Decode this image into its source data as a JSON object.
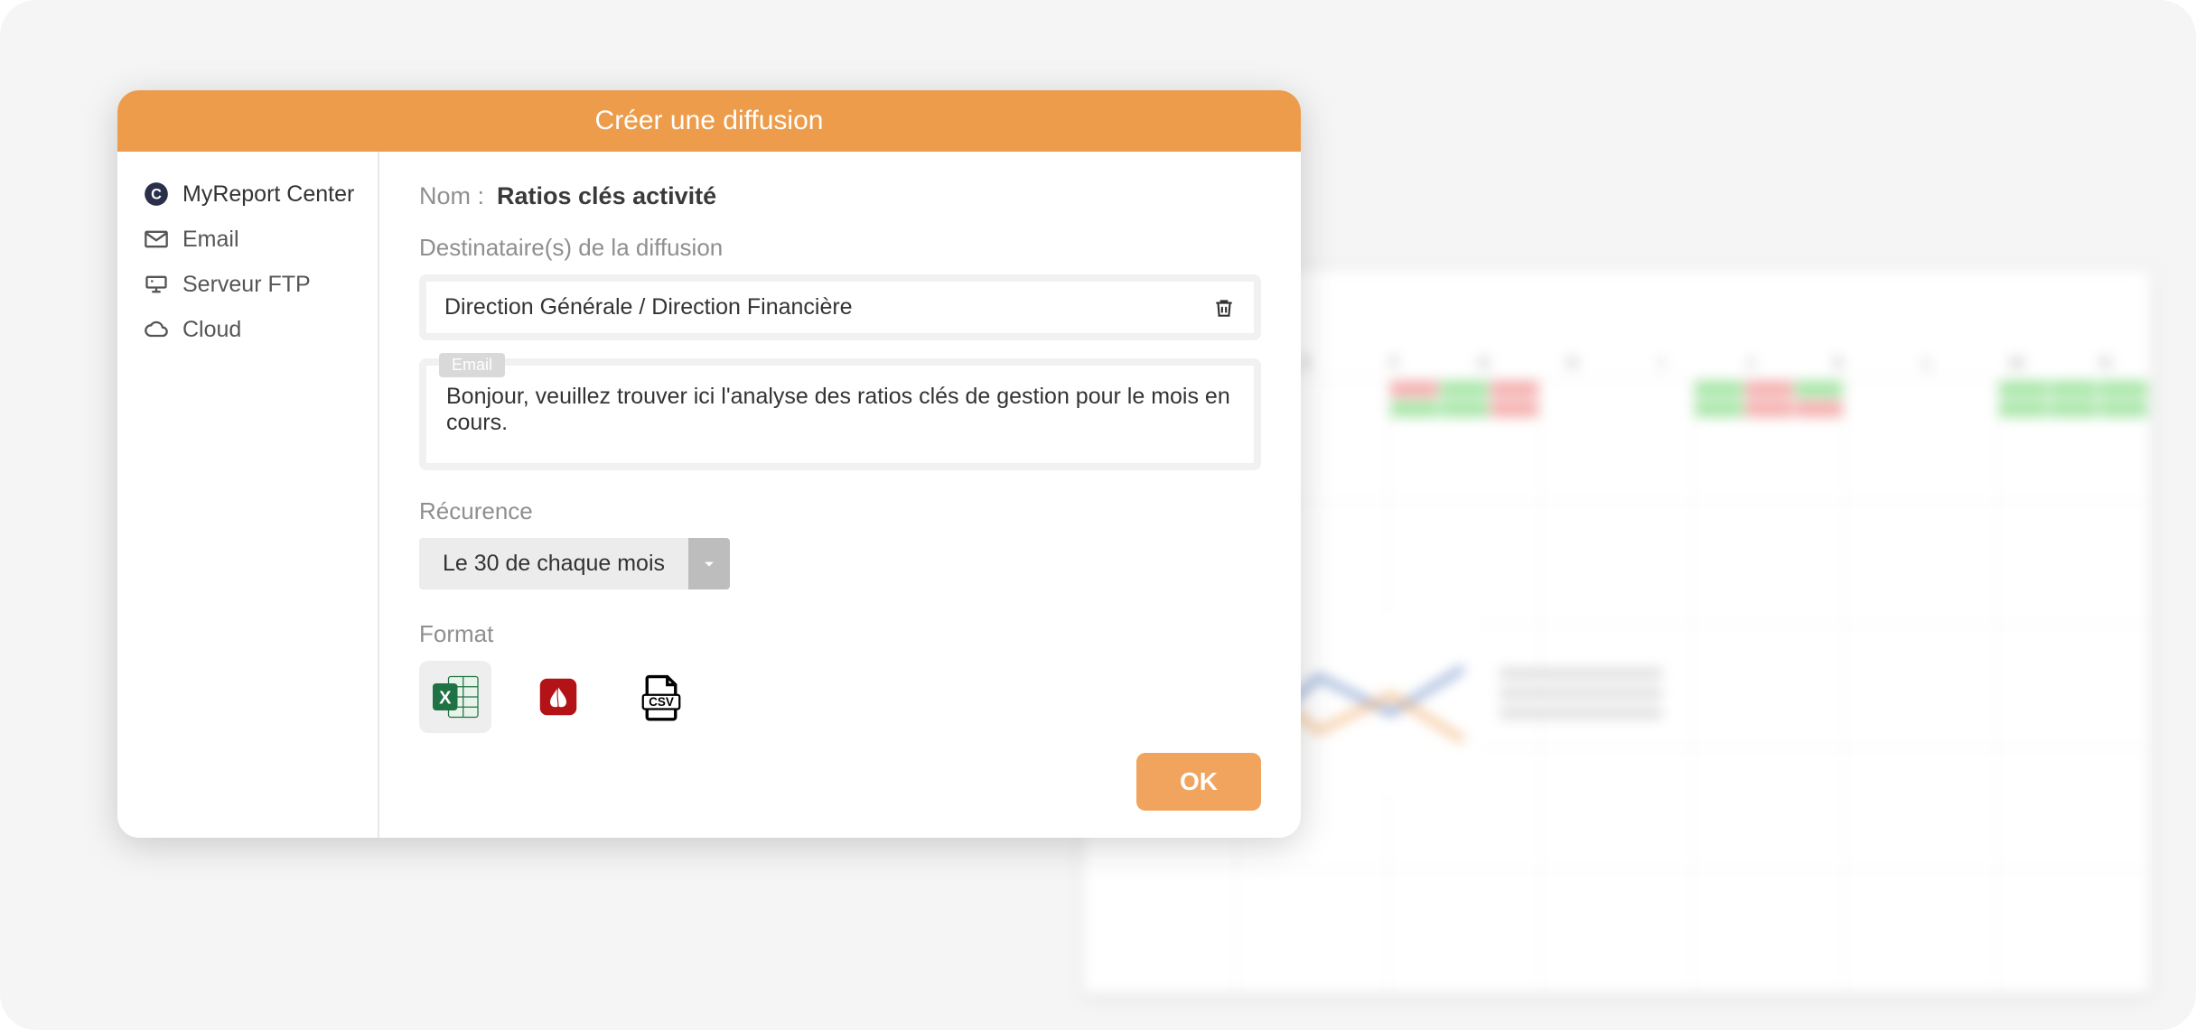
{
  "dialog": {
    "title": "Créer une diffusion",
    "sidebar": {
      "items": [
        {
          "label": "MyReport Center",
          "icon": "circle-c-icon"
        },
        {
          "label": "Email",
          "icon": "mail-icon"
        },
        {
          "label": "Serveur FTP",
          "icon": "server-icon"
        },
        {
          "label": "Cloud",
          "icon": "cloud-icon"
        }
      ]
    },
    "name_label": "Nom :",
    "name_value": "Ratios clés activité",
    "dest_label": "Destinataire(s) de la diffusion",
    "dest_value": "Direction Générale / Direction Financière",
    "email_tag": "Email",
    "email_body": "Bonjour, veuillez trouver ici l'analyse des ratios clés de gestion pour le mois en cours.",
    "recurrence_label": "Récurence",
    "recurrence_value": "Le 30 de chaque mois",
    "format_label": "Format",
    "formats": [
      {
        "name": "excel",
        "selected": true
      },
      {
        "name": "pdf",
        "selected": false
      },
      {
        "name": "csv",
        "selected": false
      }
    ],
    "ok_label": "OK"
  },
  "colors": {
    "accent": "#ec9c4a",
    "accent_btn": "#f0a45e"
  }
}
